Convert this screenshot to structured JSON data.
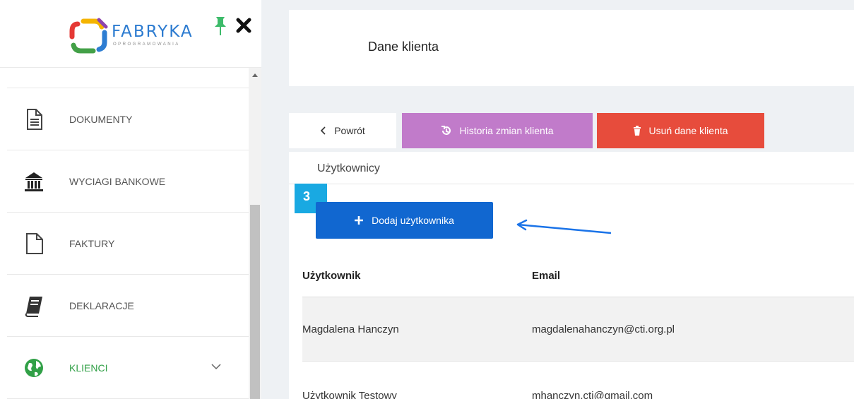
{
  "sidebar": {
    "logo": {
      "brand": "FABRYKA",
      "subtitle": "OPROGRAMOWANIA"
    },
    "items": [
      {
        "label": "DOKUMENTY",
        "icon": "document-icon"
      },
      {
        "label": "WYCIAGI BANKOWE",
        "icon": "bank-icon"
      },
      {
        "label": "FAKTURY",
        "icon": "file-icon"
      },
      {
        "label": "DEKLARACJE",
        "icon": "book-icon"
      },
      {
        "label": "KLIENCI",
        "icon": "globe-icon",
        "active": true
      }
    ]
  },
  "header": {
    "title": "Dane klienta"
  },
  "actions": {
    "back": "Powrót",
    "history": "Historia zmian klienta",
    "delete": "Usuń dane klienta"
  },
  "users": {
    "section_title": "Użytkownicy",
    "step_badge": "3",
    "add_button": "Dodaj użytkownika",
    "columns": [
      "Użytkownik",
      "Email"
    ],
    "rows": [
      {
        "name": "Magdalena Hanczyn",
        "email": "magdalenahanczyn@cti.org.pl"
      },
      {
        "name": "Użytkownik Testowy",
        "email": "mhanczyn.cti@gmail.com"
      }
    ]
  },
  "colors": {
    "history_button": "#c17bca",
    "delete_button": "#e74c3c",
    "add_button": "#1167d0",
    "badge": "#19a9e2",
    "active_menu": "#31a047"
  }
}
